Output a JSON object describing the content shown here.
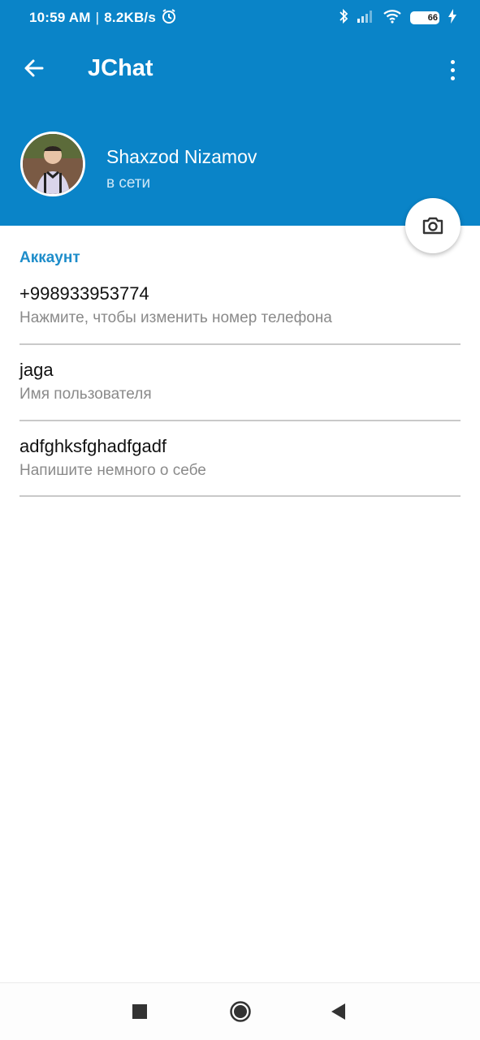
{
  "status_bar": {
    "time": "10:59 AM",
    "separator": "|",
    "net_speed": "8.2KB/s",
    "alarm_icon": "alarm-icon",
    "bluetooth_icon": "bluetooth-icon",
    "signal_icon": "signal-icon",
    "wifi_icon": "wifi-icon",
    "battery_level": "66",
    "charging_icon": "charging-icon"
  },
  "app_bar": {
    "title": "JChat",
    "back_icon": "arrow-left-icon",
    "menu_icon": "more-vert-icon"
  },
  "profile": {
    "name": "Shaxzod Nizamov",
    "status": "в сети",
    "avatar_icon": "avatar-photo"
  },
  "camera_button_icon": "camera-icon",
  "account": {
    "section_title": "Аккаунт",
    "items": [
      {
        "value": "+998933953774",
        "hint": "Нажмите, чтобы изменить номер телефона"
      },
      {
        "value": "jaga",
        "hint": "Имя пользователя"
      },
      {
        "value": "adfghksfghadfgadf",
        "hint": "Напишите немного о себе"
      }
    ]
  },
  "nav_bar": {
    "recents_icon": "square-icon",
    "home_icon": "circle-icon",
    "back_icon": "triangle-back-icon"
  },
  "colors": {
    "primary": "#0a84c8",
    "accent_text": "#1e8dca",
    "divider": "#c9c9c9",
    "hint": "#8a8a8a"
  }
}
